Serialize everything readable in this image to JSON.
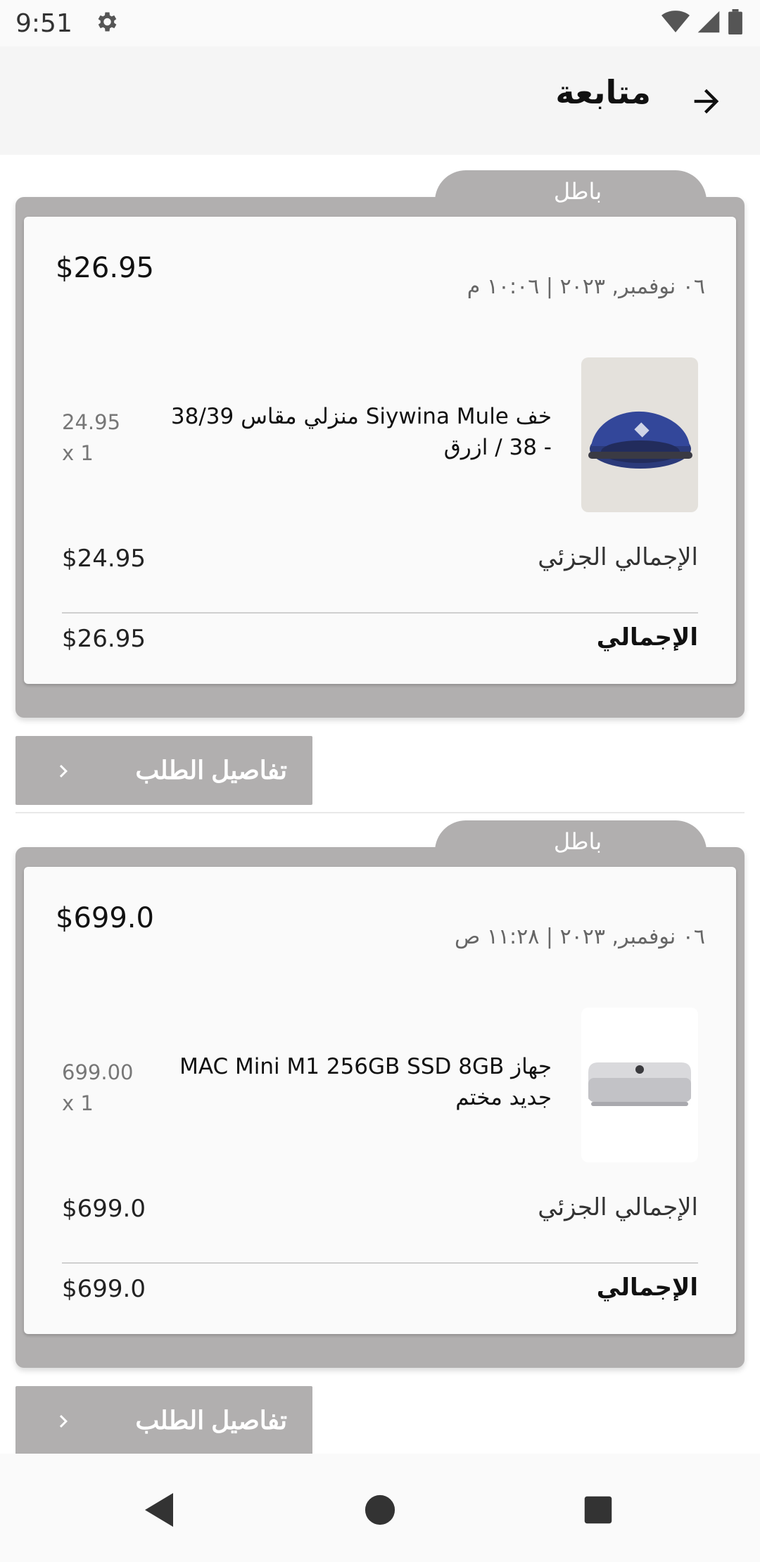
{
  "status_bar": {
    "time": "9:51"
  },
  "app_bar": {
    "title": "متابعة"
  },
  "orders": [
    {
      "status": "باطل",
      "total_top": "$26.95",
      "date": "٠٦ نوفمبر, ٢٠٢٣ | ١٠:٠٦ م",
      "item": {
        "name": "خف Siywina Mule منزلي مقاس 38/39 - 38 / ازرق",
        "unit_price": "24.95",
        "qty": "x 1"
      },
      "subtotal_label": "الإجمالي الجزئي",
      "subtotal_value": "$24.95",
      "total_label": "الإجمالي",
      "total_value": "$26.95",
      "details_button": "تفاصيل الطلب"
    },
    {
      "status": "باطل",
      "total_top": "$699.0",
      "date": "٠٦ نوفمبر, ٢٠٢٣ | ١١:٢٨ ص",
      "item": {
        "name": "جهاز MAC Mini M1 256GB SSD 8GB جديد مختم",
        "unit_price": "699.00",
        "qty": "x 1"
      },
      "subtotal_label": "الإجمالي الجزئي",
      "subtotal_value": "$699.0",
      "total_label": "الإجمالي",
      "total_value": "$699.0",
      "details_button": "تفاصيل الطلب"
    }
  ],
  "colors": {
    "accent_gray": "#b1afaf",
    "background": "#fafafa"
  },
  "icons": [
    "settings-icon",
    "wifi-icon",
    "signal-icon",
    "battery-icon",
    "back-arrow-icon",
    "chevron-left-icon",
    "nav-back-icon",
    "nav-home-icon",
    "nav-recents-icon"
  ]
}
